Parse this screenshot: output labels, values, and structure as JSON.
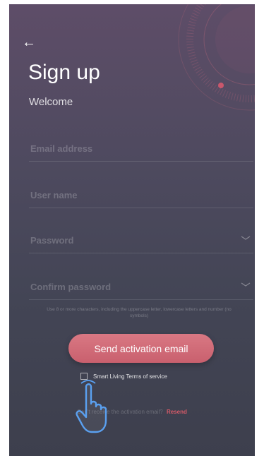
{
  "header": {
    "back_icon": "arrow-left-icon",
    "title": "Sign up",
    "subtitle": "Welcome"
  },
  "form": {
    "email": {
      "placeholder": "Email address",
      "value": ""
    },
    "username": {
      "placeholder": "User name",
      "value": ""
    },
    "password": {
      "placeholder": "Password",
      "value": "",
      "toggle_icon": "chevron-down-icon"
    },
    "confirm_password": {
      "placeholder": "Confirm password",
      "value": "",
      "toggle_icon": "chevron-down-icon"
    },
    "password_hint": "Use 8 or more characters, including the uppercase letter, lowercase letters and number (no symbols)"
  },
  "actions": {
    "send_label": "Send activation email",
    "terms_label": "Smart Living Terms of service",
    "terms_checked": false,
    "resend_question": "Can't receive the activation email?",
    "resend_link": "Resend"
  },
  "overlay": {
    "cursor_icon": "hand-pointer-icon"
  },
  "colors": {
    "accent": "#d06a77",
    "link": "#d65a68",
    "background_top": "#5e4d68",
    "background_bottom": "#3d3f4d"
  }
}
